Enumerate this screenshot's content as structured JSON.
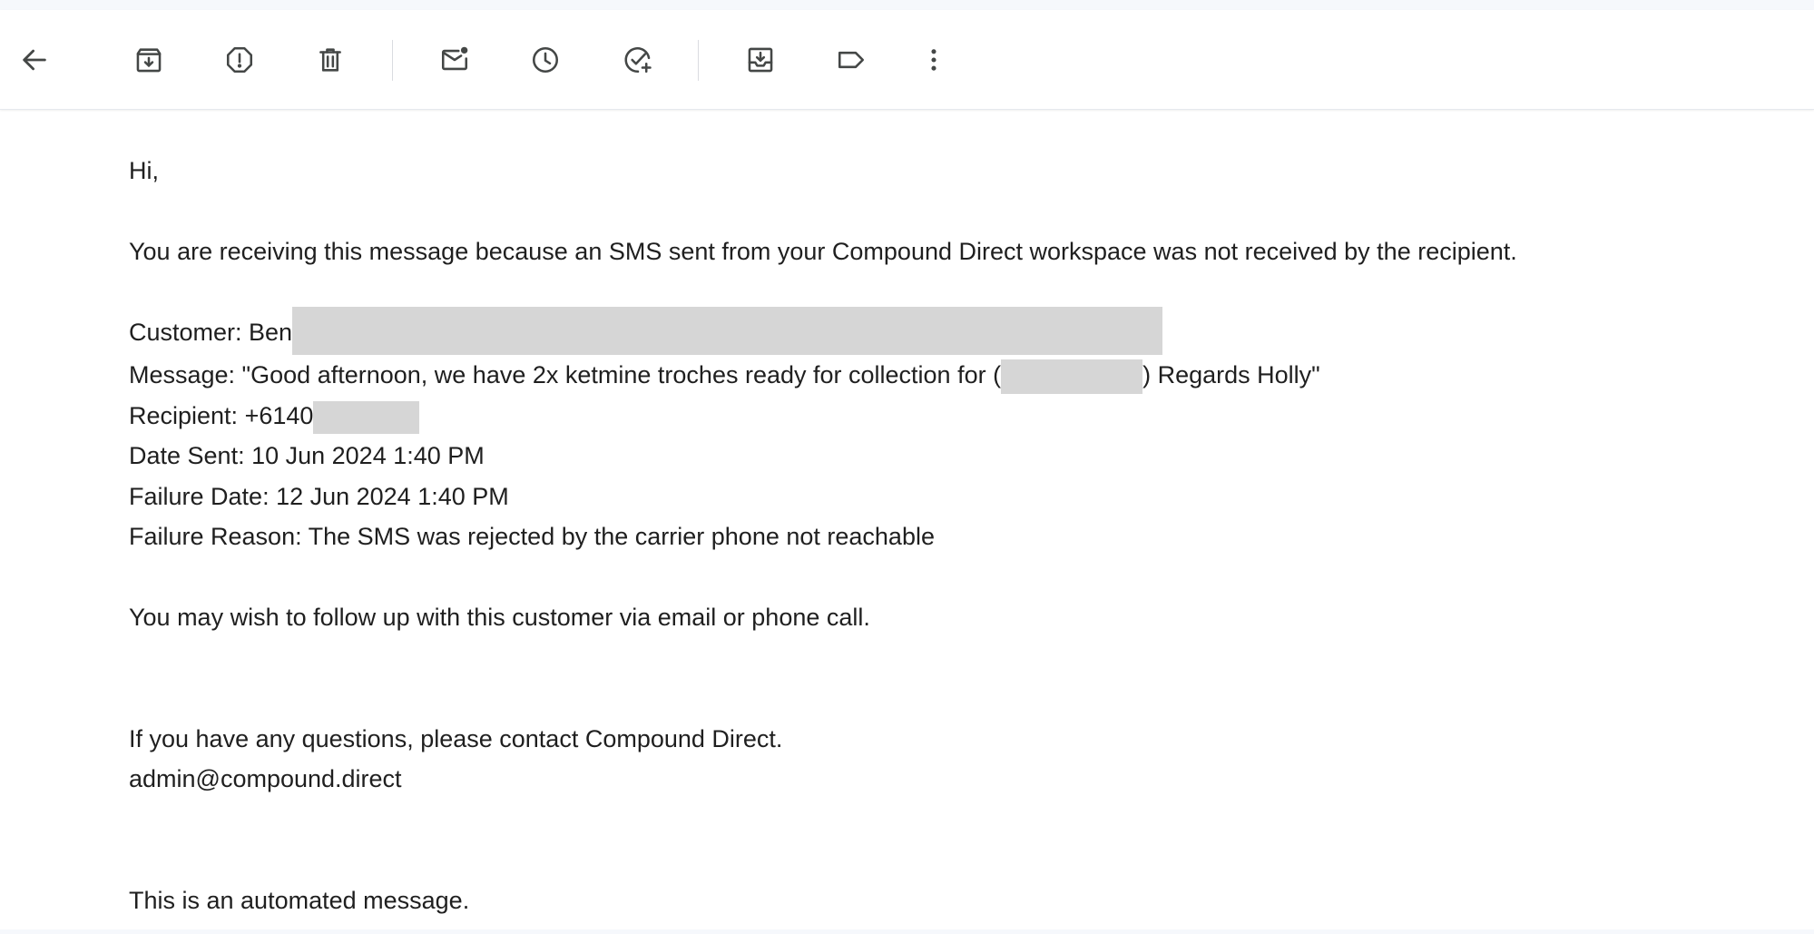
{
  "toolbar": {
    "buttons": [
      {
        "name": "back-button",
        "icon": "arrow-left-icon",
        "tooltip": "Back"
      },
      {
        "name": "archive-button",
        "icon": "archive-icon",
        "tooltip": "Archive"
      },
      {
        "name": "report-spam-button",
        "icon": "report-spam-icon",
        "tooltip": "Report spam"
      },
      {
        "name": "delete-button",
        "icon": "trash-icon",
        "tooltip": "Delete"
      },
      {
        "name": "mark-unread-button",
        "icon": "mark-unread-icon",
        "tooltip": "Mark as unread"
      },
      {
        "name": "snooze-button",
        "icon": "clock-icon",
        "tooltip": "Snooze"
      },
      {
        "name": "add-to-tasks-button",
        "icon": "add-task-icon",
        "tooltip": "Add to Tasks"
      },
      {
        "name": "move-to-button",
        "icon": "move-to-icon",
        "tooltip": "Move to"
      },
      {
        "name": "labels-button",
        "icon": "label-icon",
        "tooltip": "Labels"
      },
      {
        "name": "more-button",
        "icon": "more-vertical-icon",
        "tooltip": "More"
      }
    ],
    "icon_color": "#444746"
  },
  "email": {
    "greeting": "Hi,",
    "intro": "You are receiving this message because an SMS sent from your Compound Direct workspace was not received by the recipient.",
    "customer_label": "Customer: Ben",
    "message_prefix": "Message: \"Good afternoon, we have 2x ketmine troches ready for collection for (",
    "message_suffix": ") Regards Holly\"",
    "recipient_label": "Recipient: +6140",
    "date_sent": "Date Sent: 10 Jun 2024 1:40 PM",
    "failure_date": "Failure Date: 12 Jun 2024 1:40 PM",
    "failure_reason": "Failure Reason: The SMS was rejected by the carrier phone not reachable",
    "follow_up": "You may wish to follow up with this customer via email or phone call.",
    "questions": "If you have any questions, please contact Compound Direct.",
    "contact_email": "admin@compound.direct",
    "automated_note": "This is an automated message."
  },
  "colors": {
    "text": "#1f1f1f",
    "redaction": "#d6d6d6",
    "background": "#ffffff",
    "strip": "#f6f8fc"
  }
}
